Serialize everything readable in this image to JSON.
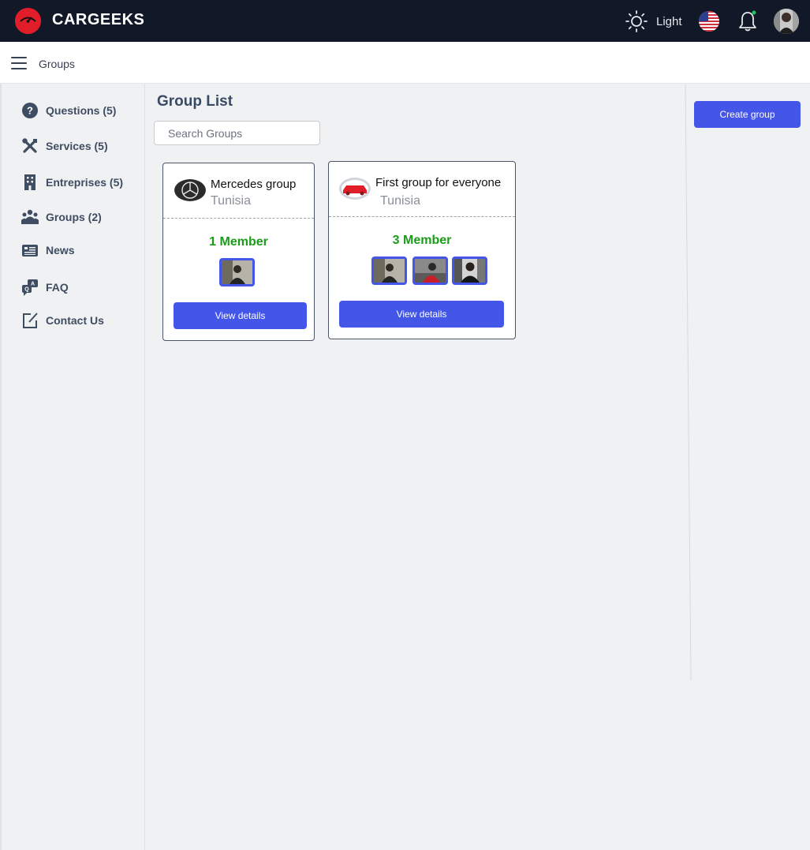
{
  "app": {
    "brand": "CARGEEKS"
  },
  "topbar": {
    "theme_label": "Light"
  },
  "breadcrumb": {
    "current": "Groups"
  },
  "sidebar": {
    "items": [
      {
        "label": "Questions (5)",
        "icon": "question-circle-icon"
      },
      {
        "label": "Services (5)",
        "icon": "tools-icon"
      },
      {
        "label": "Entreprises (5)",
        "icon": "building-icon"
      },
      {
        "label": "Groups (2)",
        "icon": "users-icon"
      },
      {
        "label": "News",
        "icon": "newspaper-icon"
      },
      {
        "label": "FAQ",
        "icon": "faq-chat-icon"
      },
      {
        "label": "Contact Us",
        "icon": "edit-square-icon"
      }
    ]
  },
  "main": {
    "title": "Group List",
    "search_placeholder": "Search Groups",
    "groups": [
      {
        "name": "Mercedes group",
        "location": "Tunisia",
        "members_label": "1 Member",
        "member_count": 1,
        "button": "View details"
      },
      {
        "name": "First group for everyone",
        "location": "Tunisia",
        "members_label": "3 Member",
        "member_count": 3,
        "button": "View details"
      }
    ]
  },
  "right": {
    "create_button": "Create group"
  },
  "colors": {
    "accent": "#4356e7",
    "topbar": "#111827",
    "member_green": "#1a9c1a",
    "logo_red": "#e11d2a"
  }
}
